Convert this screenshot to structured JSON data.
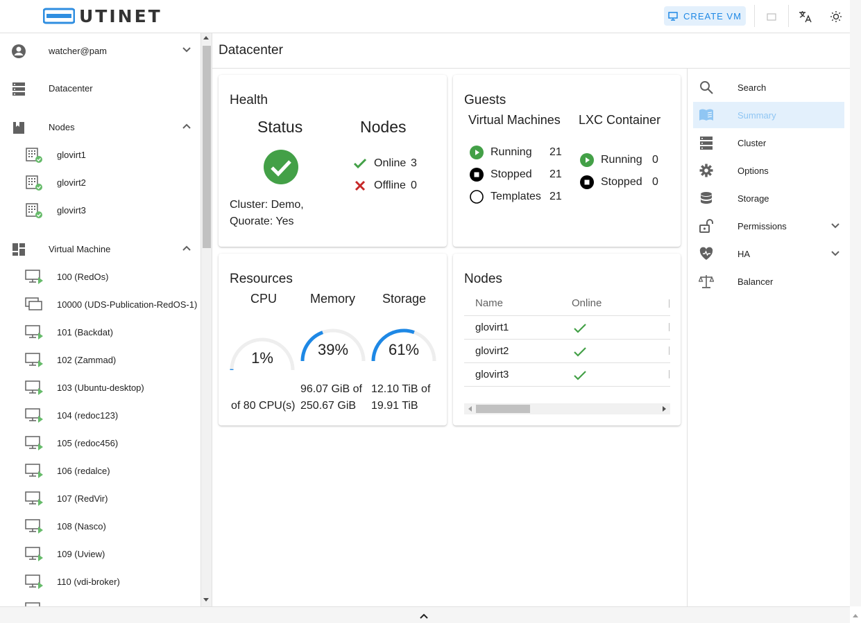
{
  "brand": {
    "name": "UTINET"
  },
  "topbar": {
    "create_vm_label": "CREATE VM"
  },
  "sidebar": {
    "user": "watcher@pam",
    "datacenter": "Datacenter",
    "nodes_label": "Nodes",
    "nodes": [
      "glovirt1",
      "glovirt2",
      "glovirt3"
    ],
    "vm_label": "Virtual Machine",
    "vms": [
      "100 (RedOs)",
      "10000 (UDS-Publication-RedOS-1)",
      "101 (Backdat)",
      "102 (Zammad)",
      "103 (Ubuntu-desktop)",
      "104 (redoc123)",
      "105 (redoc456)",
      "106 (redalce)",
      "107 (RedVir)",
      "108 (Nasco)",
      "109 (Uview)",
      "110 (vdi-broker)"
    ]
  },
  "main": {
    "title": "Datacenter"
  },
  "health": {
    "title": "Health",
    "status_label": "Status",
    "nodes_label": "Nodes",
    "online_label": "Online",
    "online_count": "3",
    "offline_label": "Offline",
    "offline_count": "0",
    "cluster": "Cluster: Demo,",
    "quorate": "Quorate: Yes"
  },
  "guests": {
    "title": "Guests",
    "vm_title": "Virtual Machines",
    "lxc_title": "LXC Container",
    "vm_running_label": "Running",
    "vm_running": "21",
    "vm_stopped_label": "Stopped",
    "vm_stopped": "21",
    "vm_templates_label": "Templates",
    "vm_templates": "21",
    "lxc_running_label": "Running",
    "lxc_running": "0",
    "lxc_stopped_label": "Stopped",
    "lxc_stopped": "0"
  },
  "resources": {
    "title": "Resources",
    "cpu": {
      "label": "CPU",
      "percent_text": "1%",
      "fraction": 0.01,
      "detail1": "of 80 CPU(s)"
    },
    "memory": {
      "label": "Memory",
      "percent_text": "39%",
      "fraction": 0.39,
      "detail1": "96.07 GiB of",
      "detail2": "250.67 GiB"
    },
    "storage": {
      "label": "Storage",
      "percent_text": "61%",
      "fraction": 0.61,
      "detail1": "12.10 TiB of",
      "detail2": "19.91 TiB"
    }
  },
  "nodes_card": {
    "title": "Nodes",
    "col_name": "Name",
    "col_online": "Online",
    "rows": [
      {
        "name": "glovirt1"
      },
      {
        "name": "glovirt2"
      },
      {
        "name": "glovirt3"
      }
    ]
  },
  "nav": {
    "items": [
      {
        "label": "Search"
      },
      {
        "label": "Summary"
      },
      {
        "label": "Cluster"
      },
      {
        "label": "Options"
      },
      {
        "label": "Storage"
      },
      {
        "label": "Permissions"
      },
      {
        "label": "HA"
      },
      {
        "label": "Balancer"
      }
    ]
  },
  "colors": {
    "accent": "#1e88e5",
    "green": "#43a047",
    "red": "#c62828"
  }
}
